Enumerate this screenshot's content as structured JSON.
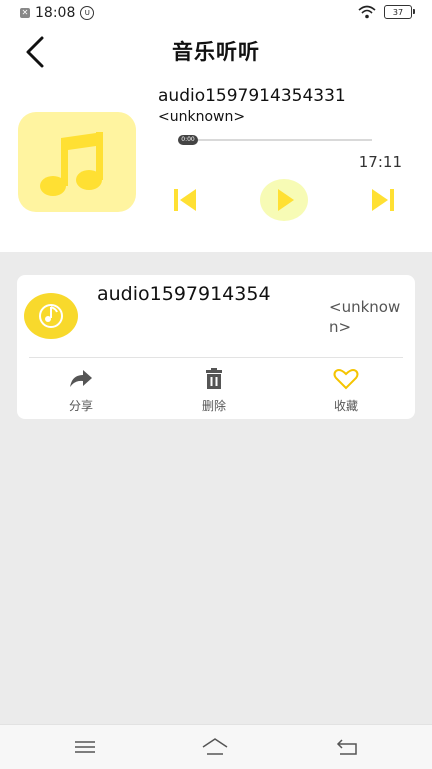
{
  "status_bar": {
    "time": "18:08",
    "battery": "37"
  },
  "header": {
    "title": "音乐听听"
  },
  "player": {
    "title": "audio1597914354331",
    "artist": "<unknown>",
    "current_time": "0:00",
    "duration": "17:11",
    "progress_fraction": 0.0
  },
  "song_list": [
    {
      "title": "audio1597914354",
      "artist": "<unknown>",
      "actions": [
        {
          "label": "分享",
          "icon": "share-icon"
        },
        {
          "label": "删除",
          "icon": "trash-icon"
        },
        {
          "label": "收藏",
          "icon": "heart-icon"
        }
      ]
    }
  ],
  "colors": {
    "accent": "#ffe033",
    "album_bg": "#fff4a0",
    "play_bg": "#f7fbb5"
  }
}
